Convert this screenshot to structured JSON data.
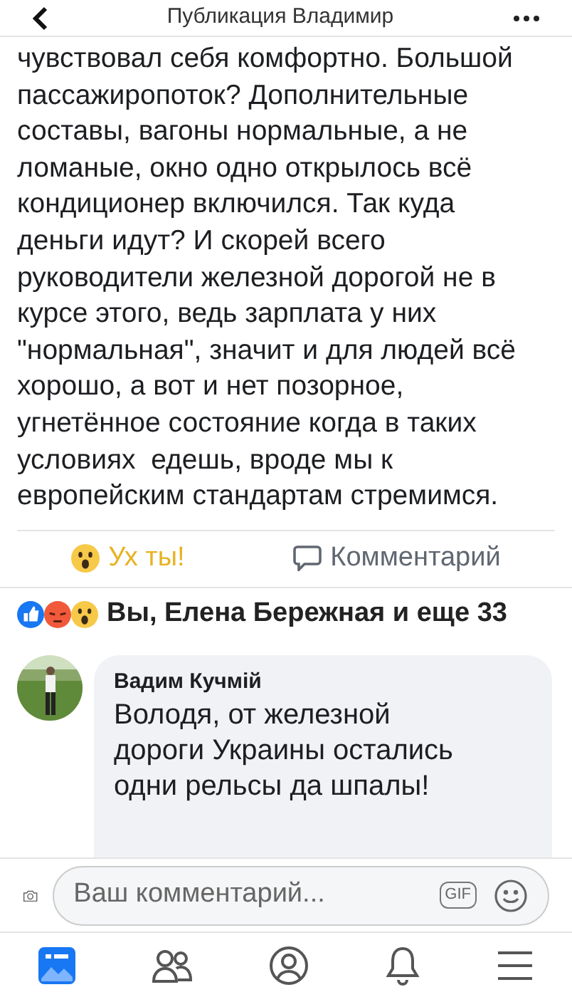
{
  "header": {
    "title": "Публикация Владимир"
  },
  "post": {
    "lines": [
      "чувствовал себя комфортно. Большой",
      "пассажиропоток? Дополнительные",
      "составы, вагоны нормальные, а не",
      "ломаные, окно одно открылось всё",
      "кондиционер включился. Так куда",
      "деньги идут? И скорей всего",
      "руководители железной дорогой не в",
      "курсе этого, ведь зарплата у них",
      "\"нормальная\", значит и для людей всё",
      "хорошо, а вот и нет позорное,",
      "угнетённое состояние когда в таких",
      "условиях  едешь, вроде мы к",
      "европейским стандартам стремимся."
    ]
  },
  "actions": [
    {
      "kind": "reaction",
      "label": "Ух ты!",
      "selected": true
    },
    {
      "kind": "comment",
      "label": "Комментарий",
      "selected": false
    }
  ],
  "reactions_summary": "Вы, Елена Бережная и еще 33",
  "comment": {
    "author": "Вадим Кучмій",
    "text": "Володя, от железной дороги Украины остались одни рельсы да шпалы!"
  },
  "composer": {
    "placeholder": "Ваш комментарий...",
    "gif": "GIF"
  },
  "tabs": [
    {
      "kind": "feed",
      "selected": true
    },
    {
      "kind": "friends",
      "selected": false
    },
    {
      "kind": "profile",
      "selected": false
    },
    {
      "kind": "notifications",
      "selected": false
    },
    {
      "kind": "menu",
      "selected": false
    }
  ]
}
